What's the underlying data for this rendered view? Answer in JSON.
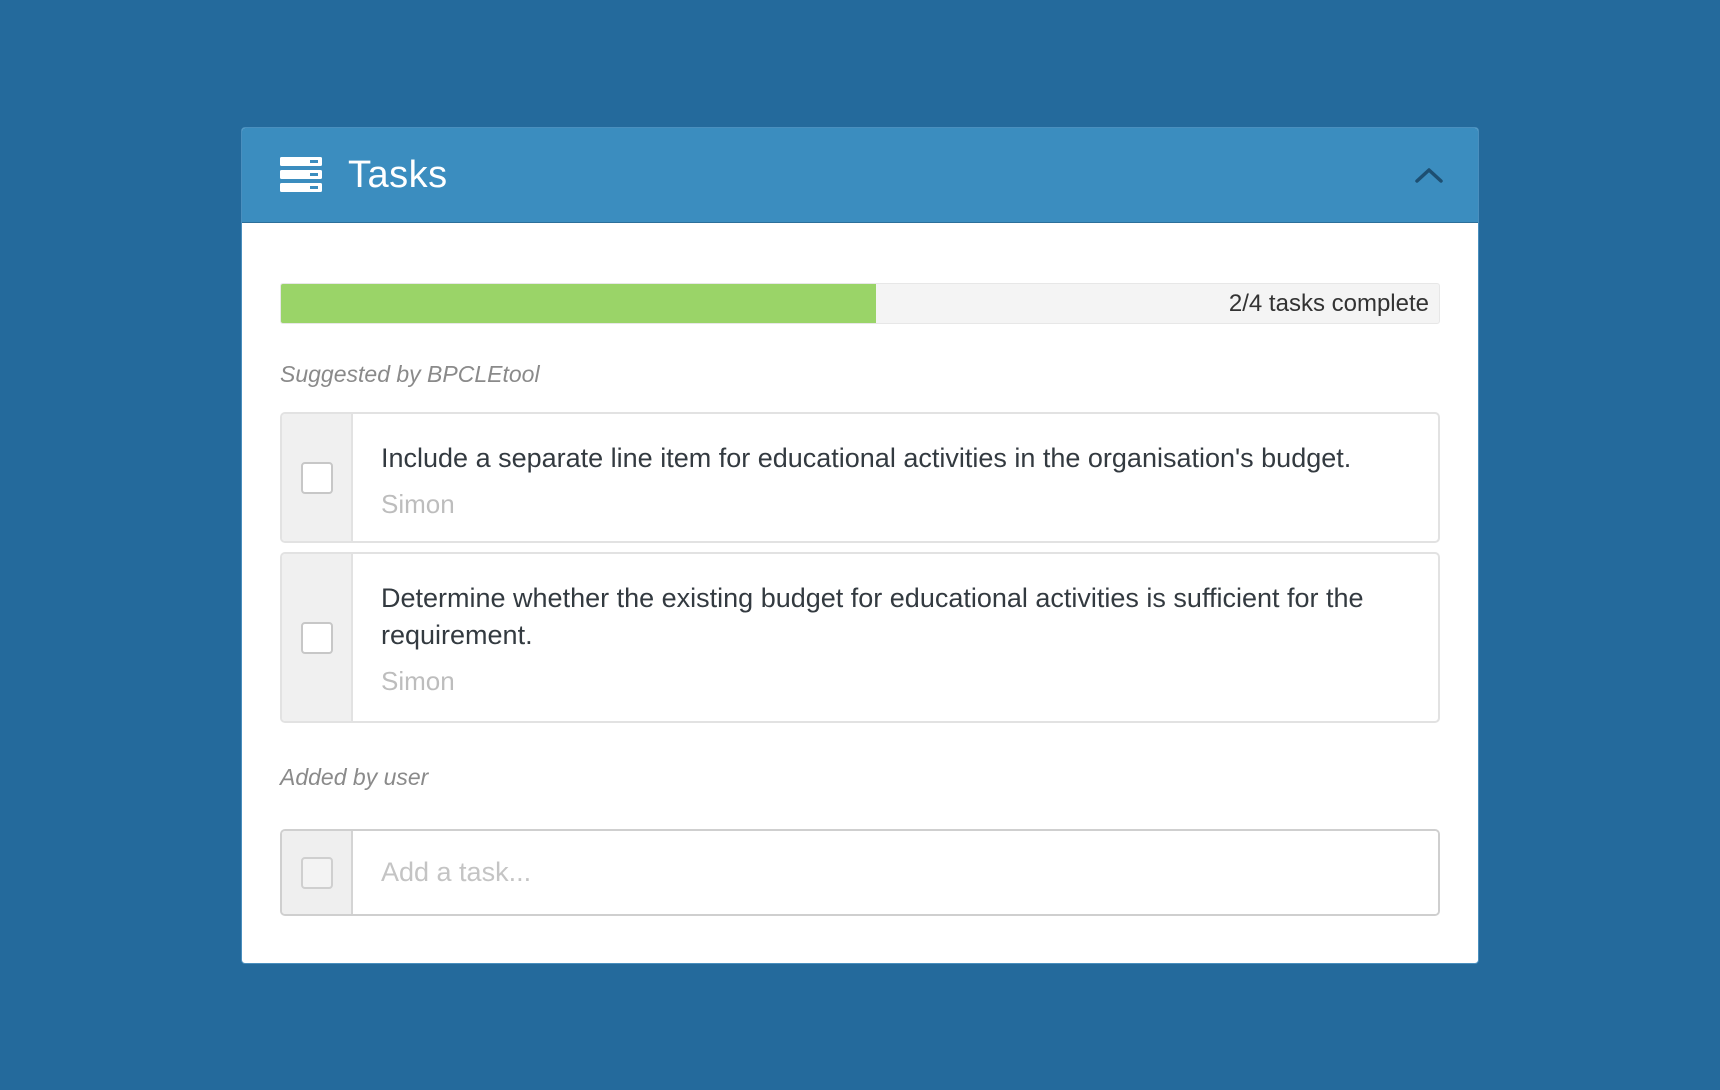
{
  "header": {
    "icon": "server-stack-icon",
    "title": "Tasks",
    "collapse_icon": "chevron-up-icon"
  },
  "progress": {
    "completed": 2,
    "total": 4,
    "fraction": 0.514,
    "label": "2/4 tasks complete",
    "fill_color": "#9ad468"
  },
  "sections": {
    "suggested_label": "Suggested by BPCLEtool",
    "added_label": "Added by user"
  },
  "suggested_tasks": [
    {
      "text": "Include a separate line item for educational activities in the organisation's budget.",
      "owner": "Simon",
      "checked": false
    },
    {
      "text": "Determine whether the existing budget for educational activities is sufficient for the requirement.",
      "owner": "Simon",
      "checked": false
    }
  ],
  "add_task": {
    "placeholder": "Add a task..."
  },
  "colors": {
    "background": "#246a9c",
    "header": "#3b8dbf"
  }
}
